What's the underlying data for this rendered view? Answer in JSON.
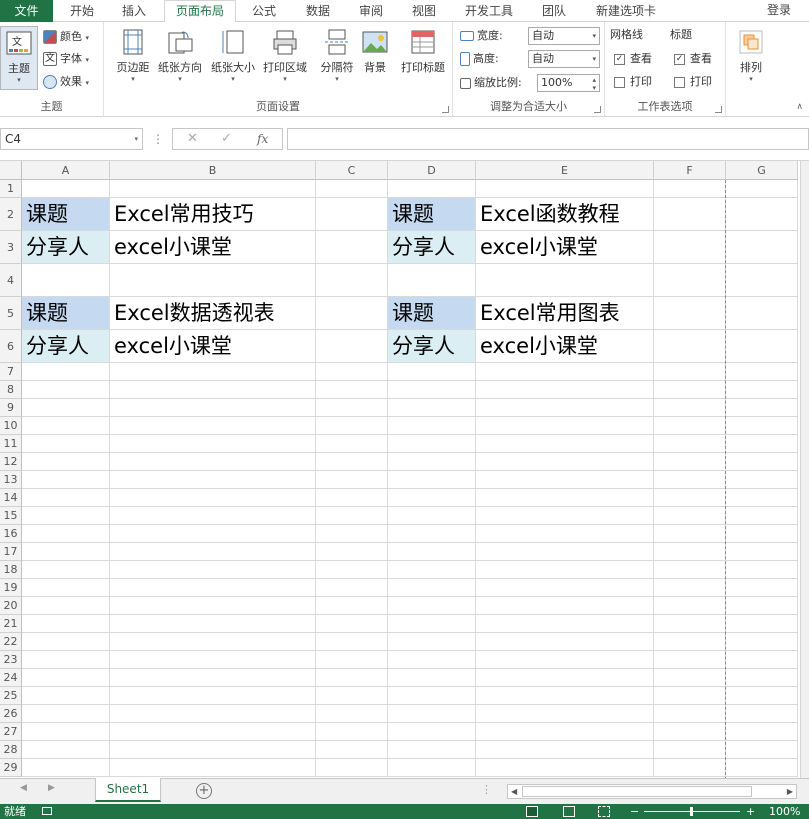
{
  "tabs": {
    "file": "文件",
    "items": [
      {
        "label": "开始"
      },
      {
        "label": "插入"
      },
      {
        "label": "页面布局",
        "active": true
      },
      {
        "label": "公式"
      },
      {
        "label": "数据"
      },
      {
        "label": "审阅"
      },
      {
        "label": "视图"
      },
      {
        "label": "开发工具"
      },
      {
        "label": "团队"
      },
      {
        "label": "新建选项卡"
      }
    ],
    "login": "登录"
  },
  "ribbon": {
    "themes": {
      "group_label": "主题",
      "theme_button": "主题",
      "colors": "颜色",
      "fonts": "字体",
      "effects": "效果"
    },
    "page_setup": {
      "group_label": "页面设置",
      "margins": "页边距",
      "orientation": "纸张方向",
      "size": "纸张大小",
      "print_area": "打印区域",
      "breaks": "分隔符",
      "background": "背景",
      "print_titles": "打印标题"
    },
    "scale_to_fit": {
      "group_label": "调整为合适大小",
      "width_label": "宽度:",
      "width_value": "自动",
      "height_label": "高度:",
      "height_value": "自动",
      "scale_label": "缩放比例:",
      "scale_value": "100%"
    },
    "sheet_options": {
      "group_label": "工作表选项",
      "gridlines": "网格线",
      "headings": "标题",
      "view": "查看",
      "print": "打印"
    },
    "arrange": {
      "label": "排列"
    }
  },
  "formula_bar": {
    "name_box": "C4",
    "dots": "⋮",
    "cancel": "✕",
    "enter": "✓",
    "fx": "fx",
    "value": ""
  },
  "columns": [
    "A",
    "B",
    "C",
    "D",
    "E",
    "F",
    "G"
  ],
  "rows": [
    "1",
    "2",
    "3",
    "4",
    "5",
    "6",
    "7",
    "8",
    "9",
    "10",
    "11",
    "12",
    "13",
    "14",
    "15",
    "16",
    "17",
    "18",
    "19",
    "20",
    "21",
    "22",
    "23",
    "24",
    "25",
    "26",
    "27",
    "28",
    "29"
  ],
  "cells": {
    "A2": "课题",
    "B2": "Excel常用技巧",
    "D2": "课题",
    "E2": "Excel函数教程",
    "A3": "分享人",
    "B3": "excel小课堂",
    "D3": "分享人",
    "E3": "excel小课堂",
    "A5": "课题",
    "B5": "Excel数据透视表",
    "D5": "课题",
    "E5": "Excel常用图表",
    "A6": "分享人",
    "B6": "excel小课堂",
    "D6": "分享人",
    "E6": "excel小课堂"
  },
  "sheet_tabs": {
    "sheets": [
      "Sheet1"
    ],
    "add": "+"
  },
  "status": {
    "ready": "就绪",
    "zoom": "100%"
  },
  "colors": {
    "accent": "#217346",
    "header_fill": "#c5d9f1",
    "label_fill": "#dbeef4"
  }
}
